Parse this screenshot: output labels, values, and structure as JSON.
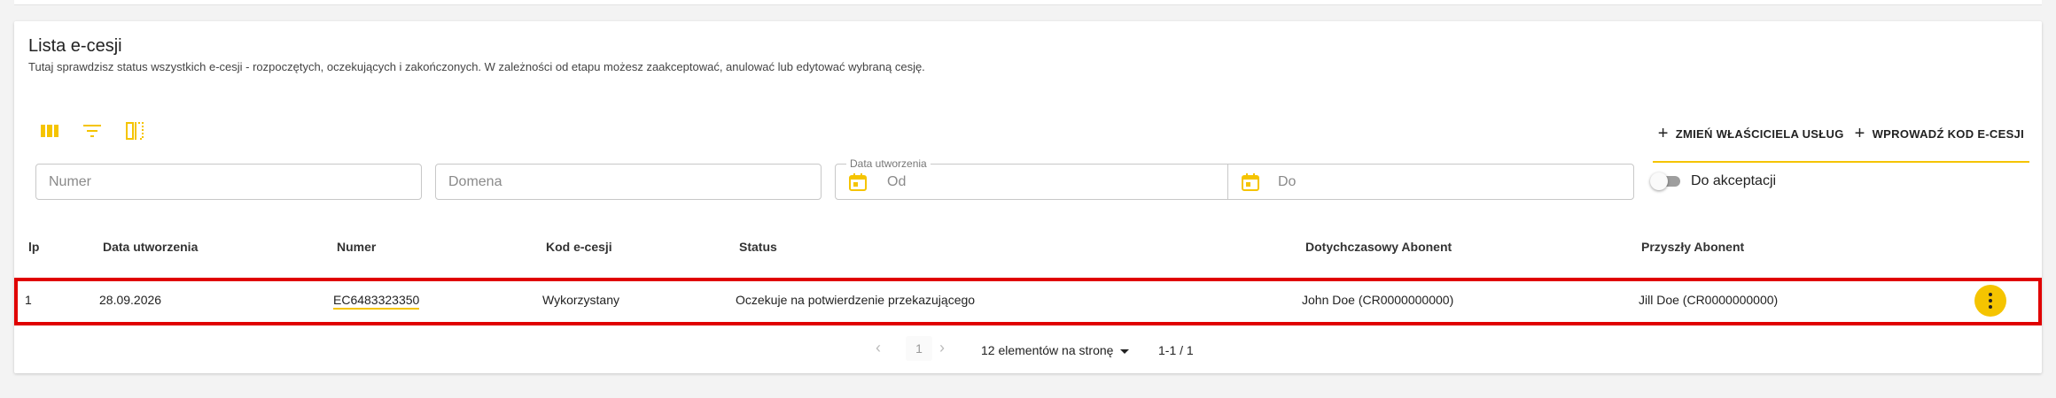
{
  "page": {
    "title": "Lista e-cesji",
    "subtitle": "Tutaj sprawdzisz status wszystkich e-cesji - rozpoczętych, oczekujących i zakończonych. W zależności od etapu możesz zaakceptować, anulować lub edytować wybraną cesję."
  },
  "toolbar": {
    "icons": [
      "columns-icon",
      "filter-icon",
      "column-resize-icon"
    ],
    "buttons": {
      "change_owner": "ZMIEŃ WŁAŚCICIELA USŁUG",
      "enter_code": "WPROWADŹ KOD E-CESJI"
    }
  },
  "filters": {
    "numer_placeholder": "Numer",
    "domena_placeholder": "Domena",
    "date_label": "Data utworzenia",
    "date_from_placeholder": "Od",
    "date_to_placeholder": "Do",
    "toggle_label": "Do akceptacji",
    "toggle_on": false
  },
  "table": {
    "headers": [
      "lp",
      "Data utworzenia",
      "Numer",
      "Kod e-cesji",
      "Status",
      "Dotychczasowy Abonent",
      "Przyszły Abonent"
    ],
    "rows": [
      {
        "lp": "1",
        "date": "28.09.2026",
        "numer": "EC6483323350",
        "kod": "Wykorzystany",
        "status": "Oczekuje na potwierdzenie przekazującego",
        "current_owner": "John Doe (CR0000000000)",
        "future_owner": "Jill Doe (CR0000000000)"
      }
    ]
  },
  "pagination": {
    "current_page": "1",
    "per_page": "12 elementów na stronę",
    "range": "1-1 / 1"
  },
  "colors": {
    "accent": "#f5c400",
    "highlight_border": "#e00000"
  }
}
